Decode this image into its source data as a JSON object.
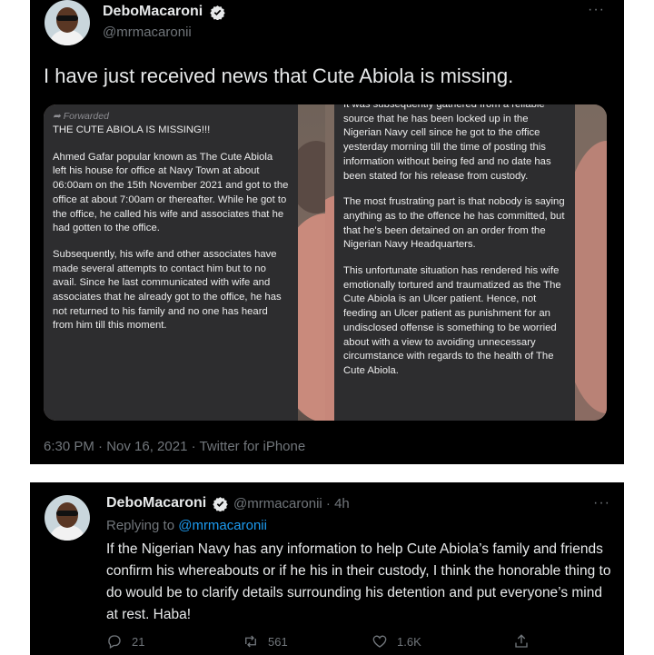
{
  "tweet": {
    "display_name": "DeboMacaroni",
    "handle": "@mrmacaronii",
    "more": "···",
    "text": "I have just received news that Cute Abiola is missing.",
    "meta": "6:30 PM · Nov 16, 2021 · Twitter for iPhone",
    "image_left": {
      "forwarded": "Forwarded",
      "heading": "THE CUTE ABIOLA IS MISSING!!!",
      "paragraphs": [
        "Ahmed Gafar popular known as The Cute Abiola left his house for office at Navy Town at about 06:00am on the 15th November 2021 and got to the office at about 7:00am or thereafter. While he got to the office, he called his wife and associates that he had gotten to the office.",
        "Subsequently, his wife and other associates have made several attempts to contact him but to no avail. Since he last communicated with wife and associates that he already got to the office, he has not returned to his family and no one has heard from him till this moment."
      ]
    },
    "image_right": {
      "paragraphs": [
        "It was subsequently gathered from a reliable source that he has been locked up in the Nigerian Navy cell since he got to the office yesterday morning till the time of posting this information without being fed and no date has been stated for his release from custody.",
        "The most frustrating part is that nobody is saying anything as to the offence he has committed, but that he's been detained on an order from the Nigerian Navy Headquarters.",
        "This unfortunate situation has rendered his wife emotionally tortured and traumatized as the The Cute Abiola is an Ulcer patient. Hence, not feeding an Ulcer patient as punishment for an undisclosed offense is something to be worried about with a view to avoiding unnecessary circumstance with regards to the health of The Cute Abiola."
      ]
    }
  },
  "reply": {
    "display_name": "DeboMacaroni",
    "handle_time": "@mrmacaronii · 4h",
    "more": "···",
    "replying_prefix": "Replying to ",
    "replying_mention": "@mrmacaronii",
    "text": "If the Nigerian Navy has any information to help Cute Abiola’s family and friends confirm his whereabouts or if he his in their custody, I think the honorable thing to do would be to clarify details surrounding his detention and put everyone’s mind at rest. Haba!",
    "actions": {
      "replies": "21",
      "retweets": "561",
      "likes": "1.6K"
    }
  },
  "colors": {
    "background": "#000000",
    "text": "#e7e9ea",
    "muted": "#71767b",
    "accent": "#1d9bf0"
  },
  "icons": [
    "verified-badge-icon",
    "reply-icon",
    "retweet-icon",
    "like-icon",
    "share-icon",
    "more-icon"
  ]
}
